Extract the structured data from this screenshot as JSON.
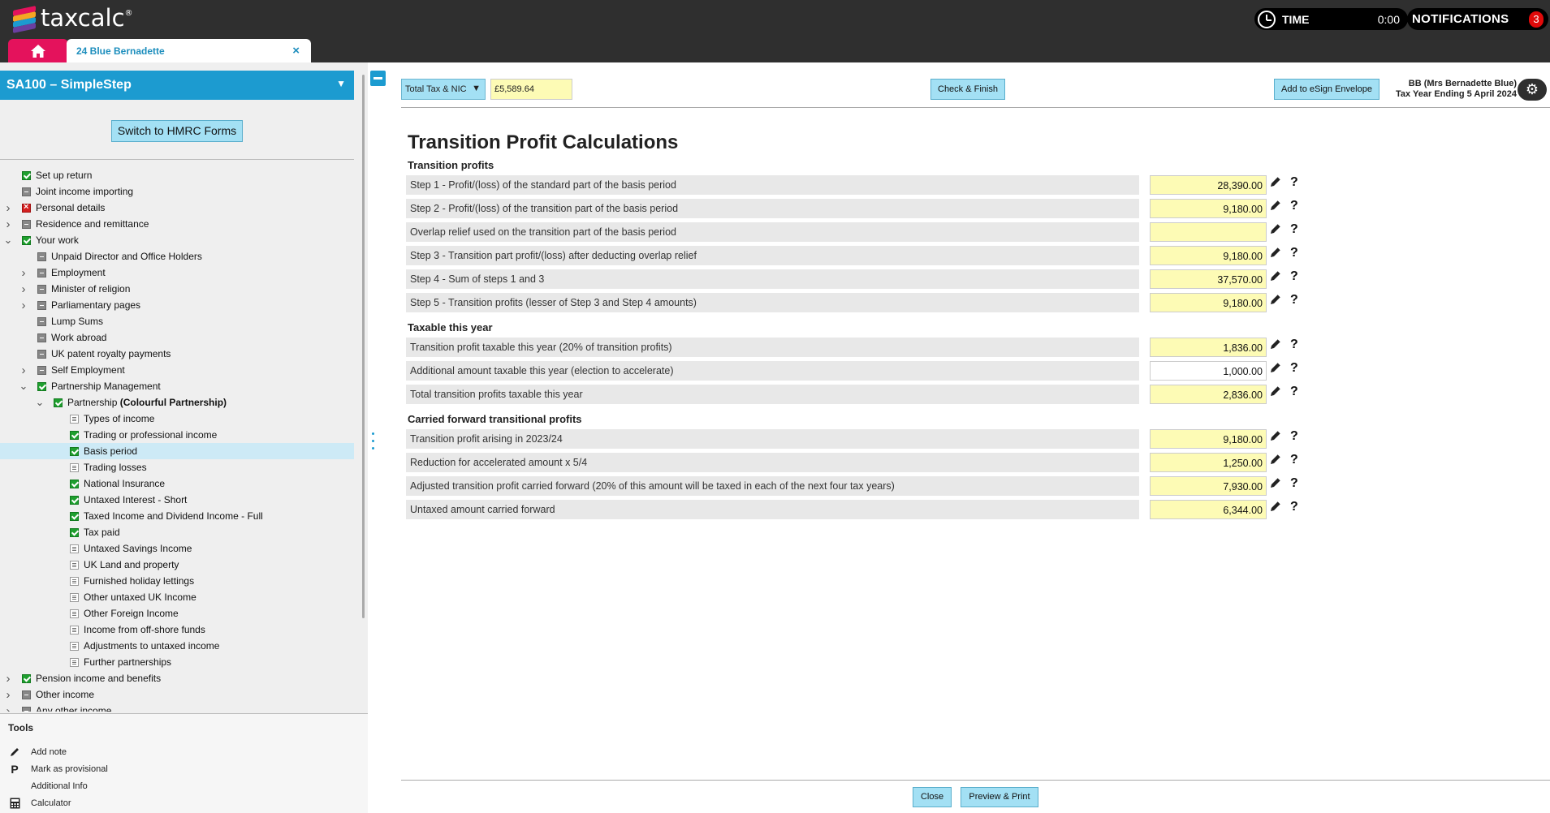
{
  "app": {
    "logo_text": "taxcalc",
    "time_label": "TIME",
    "time_value": "0:00",
    "notifications_label": "NOTIFICATIONS",
    "notifications_count": "3",
    "file_tab_label": "24 Blue Bernadette",
    "file_tab_close": "×",
    "colors": {
      "accent": "#1c9bd0",
      "home_tab": "#e4125c",
      "topbar": "#2f2f2f",
      "field_yellow": "#fdfbb5"
    }
  },
  "sidebar": {
    "header": "SA100 – SimpleStep",
    "header_arrow": "▼",
    "switch_button": "Switch to HMRC Forms",
    "tree": [
      {
        "label": "Set up return",
        "status": "ok",
        "level": 0,
        "expander": ""
      },
      {
        "label": "Joint income importing",
        "status": "grey",
        "level": 0,
        "expander": ""
      },
      {
        "label": "Personal details",
        "status": "err",
        "level": 0,
        "expander": ">"
      },
      {
        "label": "Residence and remittance",
        "status": "grey",
        "level": 0,
        "expander": ">"
      },
      {
        "label": "Your work",
        "status": "ok",
        "level": 0,
        "expander": "v"
      },
      {
        "label": "Unpaid Director and Office Holders",
        "status": "grey",
        "level": 1,
        "expander": ""
      },
      {
        "label": "Employment",
        "status": "grey",
        "level": 1,
        "expander": ">"
      },
      {
        "label": "Minister of religion",
        "status": "grey",
        "level": 1,
        "expander": ">"
      },
      {
        "label": "Parliamentary pages",
        "status": "grey",
        "level": 1,
        "expander": ">"
      },
      {
        "label": "Lump Sums",
        "status": "grey",
        "level": 1,
        "expander": ""
      },
      {
        "label": "Work abroad",
        "status": "grey",
        "level": 1,
        "expander": ""
      },
      {
        "label": "UK patent royalty payments",
        "status": "grey",
        "level": 1,
        "expander": ""
      },
      {
        "label": "Self Employment",
        "status": "grey",
        "level": 1,
        "expander": ">"
      },
      {
        "label": "Partnership Management",
        "status": "ok",
        "level": 1,
        "expander": "v"
      },
      {
        "label": "Partnership",
        "label_bold": "(Colourful Partnership)",
        "status": "ok",
        "level": 2,
        "expander": "v"
      },
      {
        "label": "Types of income",
        "status": "doc",
        "level": 3,
        "expander": ""
      },
      {
        "label": "Trading or professional income",
        "status": "ok",
        "level": 3,
        "expander": ""
      },
      {
        "label": "Basis period",
        "status": "ok",
        "level": 3,
        "expander": "",
        "selected": true
      },
      {
        "label": "Trading losses",
        "status": "doc",
        "level": 3,
        "expander": ""
      },
      {
        "label": "National Insurance",
        "status": "ok",
        "level": 3,
        "expander": ""
      },
      {
        "label": "Untaxed Interest - Short",
        "status": "ok",
        "level": 3,
        "expander": ""
      },
      {
        "label": "Taxed Income and Dividend Income - Full",
        "status": "ok",
        "level": 3,
        "expander": ""
      },
      {
        "label": "Tax paid",
        "status": "ok",
        "level": 3,
        "expander": ""
      },
      {
        "label": "Untaxed Savings Income",
        "status": "doc",
        "level": 3,
        "expander": ""
      },
      {
        "label": "UK Land and property",
        "status": "doc",
        "level": 3,
        "expander": ""
      },
      {
        "label": "Furnished holiday lettings",
        "status": "doc",
        "level": 3,
        "expander": ""
      },
      {
        "label": "Other untaxed UK Income",
        "status": "doc",
        "level": 3,
        "expander": ""
      },
      {
        "label": "Other Foreign Income",
        "status": "doc",
        "level": 3,
        "expander": ""
      },
      {
        "label": "Income from off-shore funds",
        "status": "doc",
        "level": 3,
        "expander": ""
      },
      {
        "label": "Adjustments to untaxed income",
        "status": "doc",
        "level": 3,
        "expander": ""
      },
      {
        "label": "Further partnerships",
        "status": "doc",
        "level": 3,
        "expander": ""
      },
      {
        "label": "Pension income and benefits",
        "status": "ok",
        "level": 0,
        "expander": ">"
      },
      {
        "label": "Other income",
        "status": "grey",
        "level": 0,
        "expander": ">"
      },
      {
        "label": "Any other income",
        "status": "grey",
        "level": 0,
        "expander": ">"
      }
    ],
    "tools": {
      "title": "Tools",
      "items": [
        {
          "label": "Add note",
          "icon": "pencil-icon"
        },
        {
          "label": "Mark as provisional",
          "icon": "provisional-p-icon",
          "icon_text": "P"
        },
        {
          "label": "Additional Info",
          "icon": ""
        },
        {
          "label": "Calculator",
          "icon": "calculator-icon"
        }
      ]
    }
  },
  "toolbar": {
    "tax_select": "Total Tax & NIC",
    "tax_select_caret": "▼",
    "tax_total": "£5,589.64",
    "check_finish": "Check & Finish",
    "esign": "Add to eSign Envelope",
    "user_line1": "BB (Mrs Bernadette Blue)",
    "user_line2": "Tax Year Ending 5 April 2024",
    "gear": "⚙"
  },
  "main": {
    "title": "Transition Profit Calculations",
    "sections": [
      {
        "title": "Transition profits",
        "rows": [
          {
            "label": "Step 1 - Profit/(loss) of the standard part of the basis period",
            "value": "28,390.00",
            "editable": false
          },
          {
            "label": "Step 2 - Profit/(loss) of the transition part of the basis period",
            "value": "9,180.00",
            "editable": false
          },
          {
            "label": "Overlap relief used on the transition part of the basis period",
            "value": "",
            "editable": false
          },
          {
            "label": "Step 3 - Transition part profit/(loss) after deducting overlap relief",
            "value": "9,180.00",
            "editable": false
          },
          {
            "label": "Step 4 - Sum of steps 1 and 3",
            "value": "37,570.00",
            "editable": false
          },
          {
            "label": "Step 5 - Transition profits (lesser of Step 3 and Step 4 amounts)",
            "value": "9,180.00",
            "editable": false
          }
        ]
      },
      {
        "title": "Taxable this year",
        "rows": [
          {
            "label": "Transition profit taxable this year (20% of transition profits)",
            "value": "1,836.00",
            "editable": false
          },
          {
            "label": "Additional amount taxable this year (election to accelerate)",
            "value": "1,000.00",
            "editable": true
          },
          {
            "label": "Total transition profits taxable this year",
            "value": "2,836.00",
            "editable": false
          }
        ]
      },
      {
        "title": "Carried forward transitional profits",
        "rows": [
          {
            "label": "Transition profit arising in 2023/24",
            "value": "9,180.00",
            "editable": false
          },
          {
            "label": "Reduction for accelerated amount x 5/4",
            "value": "1,250.00",
            "editable": false
          },
          {
            "label": "Adjusted transition profit carried forward (20% of this amount will be taxed in each of the next four tax years)",
            "value": "7,930.00",
            "editable": false
          },
          {
            "label": "Untaxed amount carried forward",
            "value": "6,344.00",
            "editable": false
          }
        ]
      }
    ],
    "help_glyph": "?"
  },
  "footer": {
    "close": "Close",
    "preview_print": "Preview & Print"
  }
}
